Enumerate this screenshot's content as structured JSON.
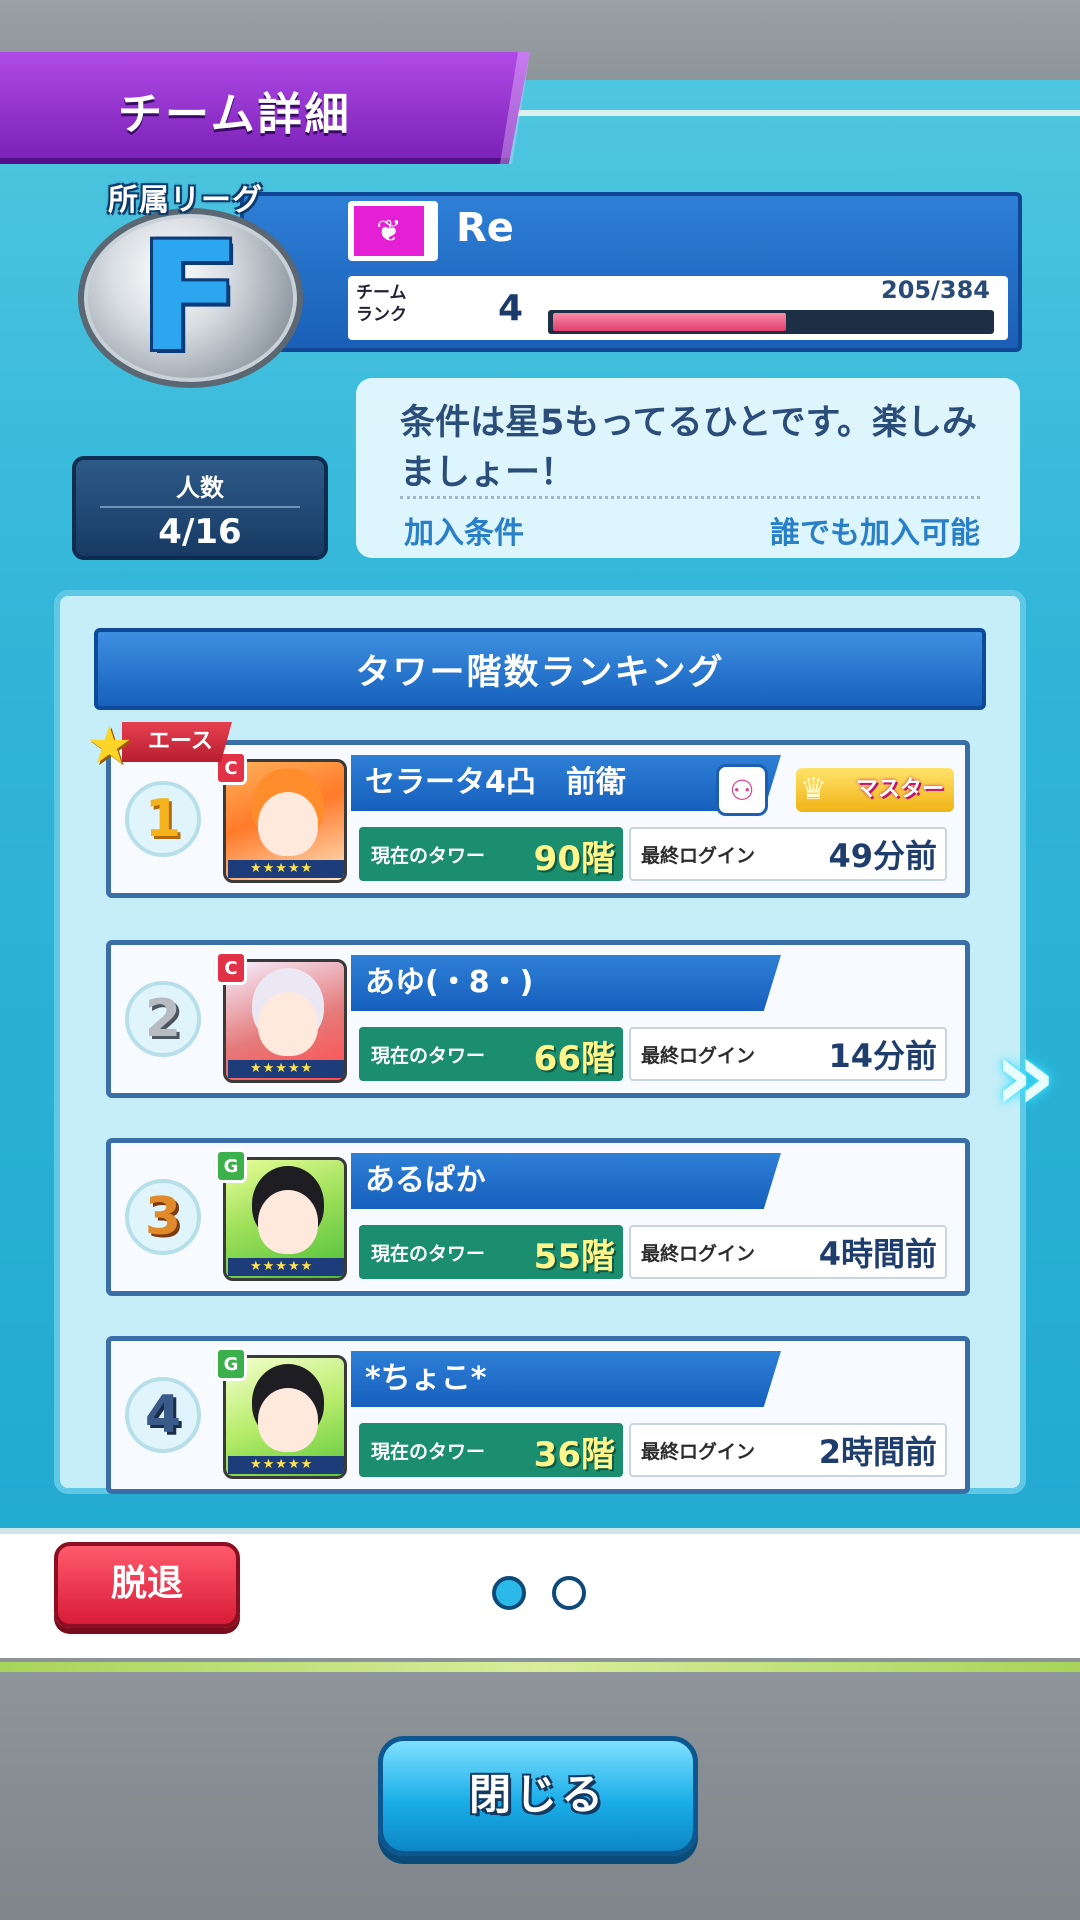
{
  "header": {
    "title": "チーム詳細"
  },
  "league": {
    "label": "所属リーグ",
    "grade": "F"
  },
  "team": {
    "emblem_icon": "wing-emblem-icon",
    "emblem_color": "#e51fd3",
    "name": "Re",
    "rank_label": "チーム\nランク",
    "rank": "4",
    "rank_progress_text": "205/384",
    "rank_progress": 0.534
  },
  "members": {
    "label": "人数",
    "value": "4/16"
  },
  "description": {
    "text": "条件は星5もってるひとです。楽しみましょー！",
    "join_label": "加入条件",
    "join_value": "誰でも加入可能"
  },
  "ranking": {
    "title": "タワー階数ランキング",
    "tower_label": "現在のタワー",
    "login_label": "最終ログイン",
    "ace_label": "エース",
    "master_label": "マスター",
    "rows": [
      {
        "rank": "1",
        "type": "C",
        "name": "セラータ4凸　前衛",
        "tower": "90階",
        "login": "49分前"
      },
      {
        "rank": "2",
        "type": "C",
        "name": "あゆ(・8・)",
        "tower": "66階",
        "login": "14分前"
      },
      {
        "rank": "3",
        "type": "G",
        "name": "あるぱか",
        "tower": "55階",
        "login": "4時間前"
      },
      {
        "rank": "4",
        "type": "G",
        "name": "*ちょこ*",
        "tower": "36階",
        "login": "2時間前"
      }
    ]
  },
  "footer": {
    "leave_label": "脱退",
    "close_label": "閉じる",
    "current_page": 1,
    "page_count": 2
  }
}
